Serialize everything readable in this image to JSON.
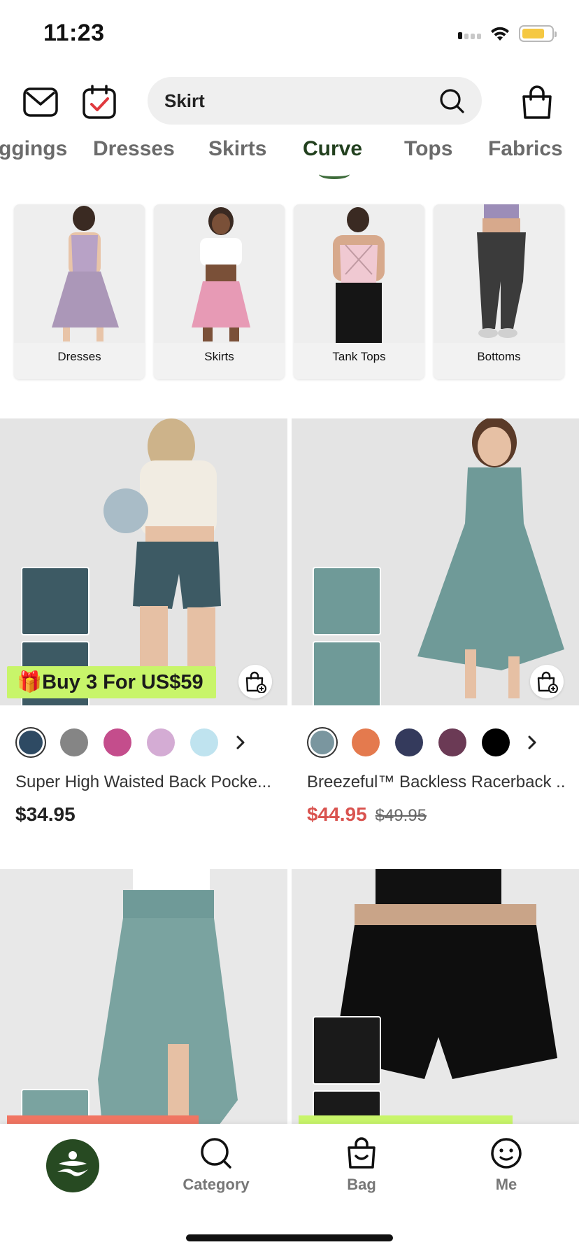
{
  "status_bar": {
    "time": "11:23"
  },
  "header": {
    "mail_icon": "envelope-icon",
    "calendar_icon": "calendar-check-icon",
    "search": {
      "value": "Skirt",
      "icon": "search-icon"
    },
    "bag_icon": "shopping-bag-icon"
  },
  "tabs": [
    {
      "label": "ggings"
    },
    {
      "label": "Dresses"
    },
    {
      "label": "Skirts"
    },
    {
      "label": "Curve",
      "active": true
    },
    {
      "label": "Tops"
    },
    {
      "label": "Fabrics"
    }
  ],
  "categories": [
    {
      "label": "Dresses"
    },
    {
      "label": "Skirts"
    },
    {
      "label": "Tank Tops"
    },
    {
      "label": "Bottoms"
    }
  ],
  "products": [
    {
      "name": "Super High Waisted Back Pocke...",
      "price": "$34.95",
      "promo": "🎁Buy 3 For US$59",
      "swatches": [
        "#2e4a63",
        "#858585",
        "#c44d8c",
        "#d4acd4",
        "#bfe3ef"
      ],
      "accent": "#3d5a64"
    },
    {
      "name": "Breezeful™ Backless Racerback ...",
      "price": "$44.95",
      "old_price": "$49.95",
      "swatches": [
        "#7a969f",
        "#e47a4e",
        "#343a5c",
        "#6b3a55",
        "#000000"
      ],
      "accent": "#6f9a98"
    }
  ],
  "tabbar": {
    "home_icon": "brand-logo-icon",
    "items": [
      {
        "label": "Category",
        "icon": "category-search-icon"
      },
      {
        "label": "Bag",
        "icon": "bag-smile-icon"
      },
      {
        "label": "Me",
        "icon": "face-icon"
      }
    ]
  }
}
